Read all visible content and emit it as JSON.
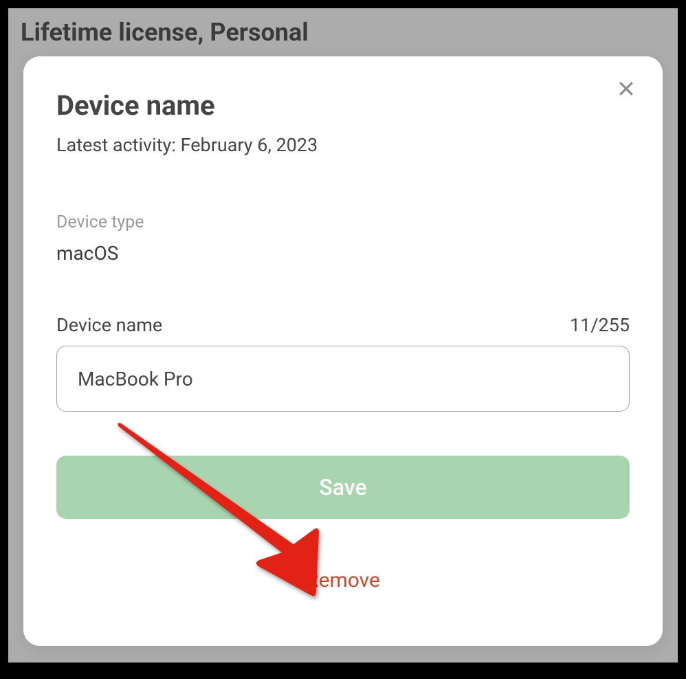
{
  "page": {
    "header": "Lifetime license, Personal"
  },
  "modal": {
    "title": "Device name",
    "subtitle_prefix": "Latest activity: ",
    "latest_activity": "February 6, 2023",
    "device_type_label": "Device type",
    "device_type_value": "macOS",
    "device_name_label": "Device name",
    "char_count": "11/255",
    "device_name_value": "MacBook Pro",
    "save_label": "Save",
    "remove_label": "Remove"
  }
}
